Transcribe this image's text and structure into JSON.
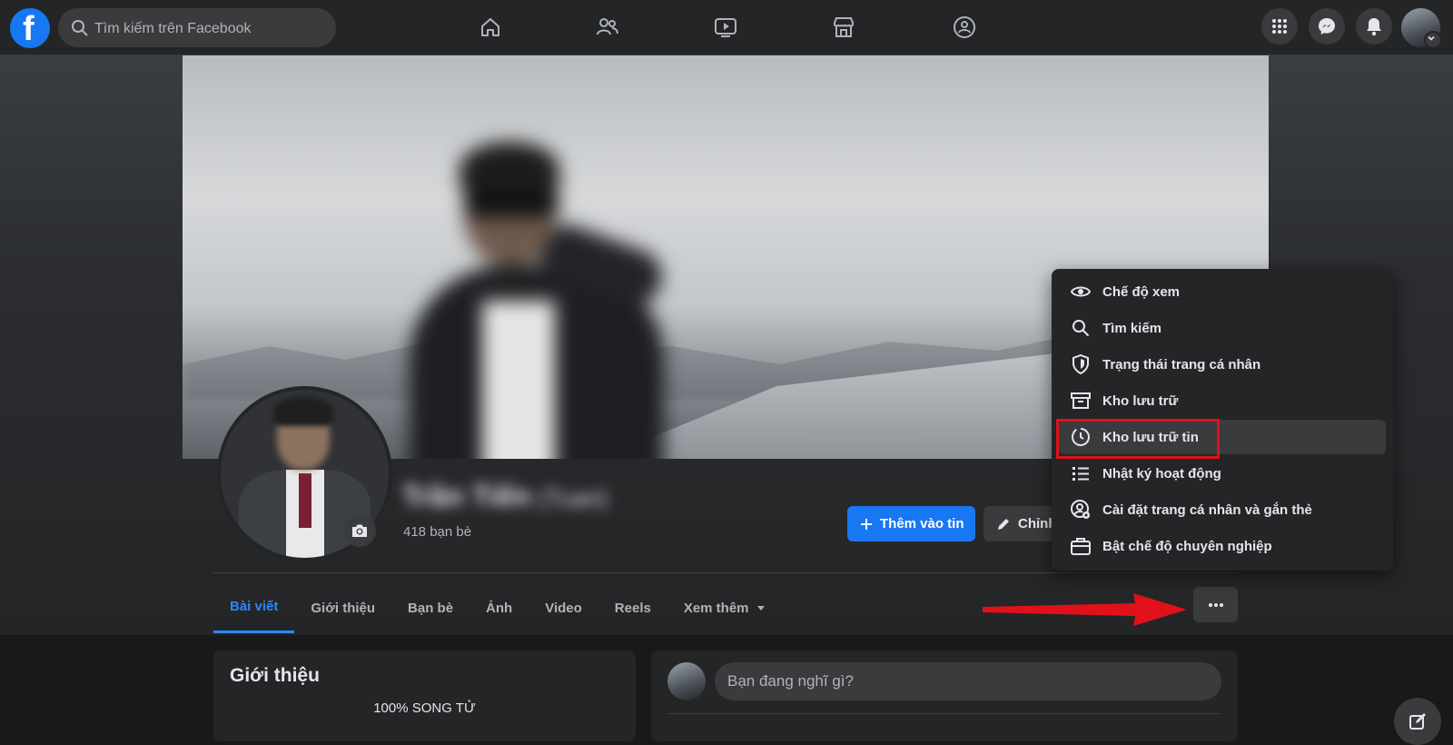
{
  "topbar": {
    "search_placeholder": "Tìm kiếm trên Facebook",
    "nav_icons": [
      "home-icon",
      "friends-icon",
      "watch-icon",
      "marketplace-icon",
      "groups-icon"
    ],
    "right_icons": [
      "menu-grid-icon",
      "messenger-icon",
      "bell-icon"
    ]
  },
  "profile": {
    "name": "Trần Tiến",
    "alt_name": "(Tuan)",
    "friends_count": "418 bạn bè",
    "add_story_label": "Thêm vào tin",
    "edit_label": "Chỉnh"
  },
  "tabs": [
    {
      "label": "Bài viết",
      "active": true
    },
    {
      "label": "Giới thiệu"
    },
    {
      "label": "Bạn bè"
    },
    {
      "label": "Ảnh"
    },
    {
      "label": "Video"
    },
    {
      "label": "Reels"
    },
    {
      "label": "Xem thêm"
    }
  ],
  "dropdown_menu": {
    "items": [
      {
        "label": "Chế độ xem",
        "icon": "eye-icon"
      },
      {
        "label": "Tìm kiếm",
        "icon": "search-icon"
      },
      {
        "label": "Trạng thái trang cá nhân",
        "icon": "shield-icon"
      },
      {
        "label": "Kho lưu trữ",
        "icon": "archive-icon"
      },
      {
        "label": "Kho lưu trữ tin",
        "icon": "clock-icon",
        "highlighted": true
      },
      {
        "label": "Nhật ký hoạt động",
        "icon": "list-icon"
      },
      {
        "label": "Cài đặt trang cá nhân và gắn thẻ",
        "icon": "profile-settings-icon"
      },
      {
        "label": "Bật chế độ chuyên nghiệp",
        "icon": "briefcase-icon"
      }
    ]
  },
  "intro": {
    "title": "Giới thiệu",
    "bio": "100% SONG TỬ"
  },
  "composer": {
    "placeholder": "Bạn đang nghĩ gì?"
  },
  "colors": {
    "accent": "#1877f2",
    "annotation_red": "#e0111a",
    "surface": "#242526",
    "background": "#18191a"
  }
}
